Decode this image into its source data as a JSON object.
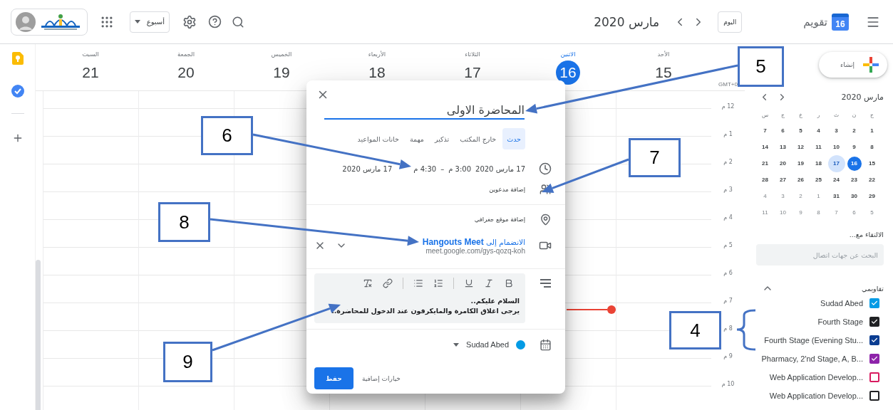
{
  "top_bar": {
    "app_name": "تقويم",
    "logo_day": "16",
    "today_button": "اليوم",
    "period": "مارس 2020",
    "view_selector": "أسبوع"
  },
  "week": {
    "timezone": "GMT+0",
    "days": [
      {
        "name": "الأحد",
        "date": "15",
        "today": false
      },
      {
        "name": "الاثنين",
        "date": "16",
        "today": true
      },
      {
        "name": "الثلاثاء",
        "date": "17",
        "today": false
      },
      {
        "name": "الأربعاء",
        "date": "18",
        "today": false
      },
      {
        "name": "الخميس",
        "date": "19",
        "today": false
      },
      {
        "name": "الجمعة",
        "date": "20",
        "today": false
      },
      {
        "name": "السبت",
        "date": "21",
        "today": false
      }
    ]
  },
  "hours": [
    "12 م",
    "1 م",
    "2 م",
    "3 م",
    "4 م",
    "5 م",
    "6 م",
    "7 م",
    "8 م",
    "9 م",
    "10 م"
  ],
  "dialog": {
    "title": "المحاضرة الاولى",
    "tabs": [
      {
        "label": "حدث",
        "selected": true
      },
      {
        "label": "خارج المكتب",
        "selected": false
      },
      {
        "label": "تذكير",
        "selected": false
      },
      {
        "label": "مهمة",
        "selected": false
      },
      {
        "label": "خانات المواعيد",
        "selected": false
      }
    ],
    "date_start": "17 مارس 2020",
    "time_start": "3:00 م",
    "separator": "–",
    "time_end": "4:30 م",
    "date_end": "17 مارس 2020",
    "guests": "إضافة مدعوين",
    "location": "إضافة موقع جغرافي",
    "meet_link": "الانضمام إلى **Hangouts Meet**",
    "meet_url": "meet.google.com/gys-qozq-koh",
    "description": [
      "السلام عليكم..",
      "يرجى اغلاق الكامرة والمايكرفون عند الدخول للمحاضرة.."
    ],
    "calendar": {
      "name": "Sudad Abed",
      "color": "#039be5"
    },
    "more_options": "خيارات إضافية",
    "save": "حفظ"
  },
  "sidebar": {
    "create": "إنشاء",
    "mini_calendar": {
      "title": "مارس 2020",
      "weekdays": [
        "ح",
        "ن",
        "ث",
        "ر",
        "خ",
        "ج",
        "س"
      ],
      "weeks": [
        [
          {
            "day": "1",
            "other_month": false,
            "today": false,
            "selected": false
          },
          {
            "day": "2",
            "other_month": false,
            "today": false,
            "selected": false
          },
          {
            "day": "3",
            "other_month": false,
            "today": false,
            "selected": false
          },
          {
            "day": "4",
            "other_month": false,
            "today": false,
            "selected": false
          },
          {
            "day": "5",
            "other_month": false,
            "today": false,
            "selected": false
          },
          {
            "day": "6",
            "other_month": false,
            "today": false,
            "selected": false
          },
          {
            "day": "7",
            "other_month": false,
            "today": false,
            "selected": false
          }
        ],
        [
          {
            "day": "8",
            "other_month": false,
            "today": false,
            "selected": false
          },
          {
            "day": "9",
            "other_month": false,
            "today": false,
            "selected": false
          },
          {
            "day": "10",
            "other_month": false,
            "today": false,
            "selected": false
          },
          {
            "day": "11",
            "other_month": false,
            "today": false,
            "selected": false
          },
          {
            "day": "12",
            "other_month": false,
            "today": false,
            "selected": false
          },
          {
            "day": "13",
            "other_month": false,
            "today": false,
            "selected": false
          },
          {
            "day": "14",
            "other_month": false,
            "today": false,
            "selected": false
          }
        ],
        [
          {
            "day": "15",
            "other_month": false,
            "today": false,
            "selected": false
          },
          {
            "day": "16",
            "other_month": false,
            "today": true,
            "selected": false
          },
          {
            "day": "17",
            "other_month": false,
            "today": false,
            "selected": true
          },
          {
            "day": "18",
            "other_month": false,
            "today": false,
            "selected": false
          },
          {
            "day": "19",
            "other_month": false,
            "today": false,
            "selected": false
          },
          {
            "day": "20",
            "other_month": false,
            "today": false,
            "selected": false
          },
          {
            "day": "21",
            "other_month": false,
            "today": false,
            "selected": false
          }
        ],
        [
          {
            "day": "22",
            "other_month": false,
            "today": false,
            "selected": false
          },
          {
            "day": "23",
            "other_month": false,
            "today": false,
            "selected": false
          },
          {
            "day": "24",
            "other_month": false,
            "today": false,
            "selected": false
          },
          {
            "day": "25",
            "other_month": false,
            "today": false,
            "selected": false
          },
          {
            "day": "26",
            "other_month": false,
            "today": false,
            "selected": false
          },
          {
            "day": "27",
            "other_month": false,
            "today": false,
            "selected": false
          },
          {
            "day": "28",
            "other_month": false,
            "today": false,
            "selected": false
          }
        ],
        [
          {
            "day": "29",
            "other_month": false,
            "today": false,
            "selected": false
          },
          {
            "day": "30",
            "other_month": false,
            "today": false,
            "selected": false
          },
          {
            "day": "31",
            "other_month": false,
            "today": false,
            "selected": false
          },
          {
            "day": "1",
            "other_month": true,
            "today": false,
            "selected": false
          },
          {
            "day": "2",
            "other_month": true,
            "today": false,
            "selected": false
          },
          {
            "day": "3",
            "other_month": true,
            "today": false,
            "selected": false
          },
          {
            "day": "4",
            "other_month": true,
            "today": false,
            "selected": false
          }
        ],
        [
          {
            "day": "5",
            "other_month": true,
            "today": false,
            "selected": false
          },
          {
            "day": "6",
            "other_month": true,
            "today": false,
            "selected": false
          },
          {
            "day": "7",
            "other_month": true,
            "today": false,
            "selected": false
          },
          {
            "day": "8",
            "other_month": true,
            "today": false,
            "selected": false
          },
          {
            "day": "9",
            "other_month": true,
            "today": false,
            "selected": false
          },
          {
            "day": "10",
            "other_month": true,
            "today": false,
            "selected": false
          },
          {
            "day": "11",
            "other_month": true,
            "today": false,
            "selected": false
          }
        ]
      ]
    },
    "meet_with": "الالتقاء مع...",
    "contact_search": {
      "placeholder": "البحث عن جهات اتصال"
    },
    "my_calendars": {
      "title": "تقاويمي",
      "expanded": true,
      "items": [
        {
          "name": "Sudad Abed",
          "checked": true,
          "color": "#039be5"
        },
        {
          "name": "Fourth Stage",
          "checked": true,
          "color": "#202124"
        },
        {
          "name": "Fourth Stage (Evening Stu...",
          "checked": true,
          "color": "#0b3d91"
        },
        {
          "name": "Pharmacy, 2'nd Stage, A, B...",
          "checked": true,
          "color": "#8e24aa"
        },
        {
          "name": "Web Application Develop...",
          "checked": false,
          "color": "#d81b60"
        },
        {
          "name": "Web Application Develop...",
          "checked": false,
          "color": "#202124"
        }
      ]
    }
  },
  "annotations": [
    {
      "label": "5",
      "kind": "arrow"
    },
    {
      "label": "6",
      "kind": "arrow"
    },
    {
      "label": "7",
      "kind": "arrow"
    },
    {
      "label": "8",
      "kind": "arrow"
    },
    {
      "label": "4",
      "kind": "brace"
    },
    {
      "label": "9",
      "kind": "arrow"
    }
  ]
}
